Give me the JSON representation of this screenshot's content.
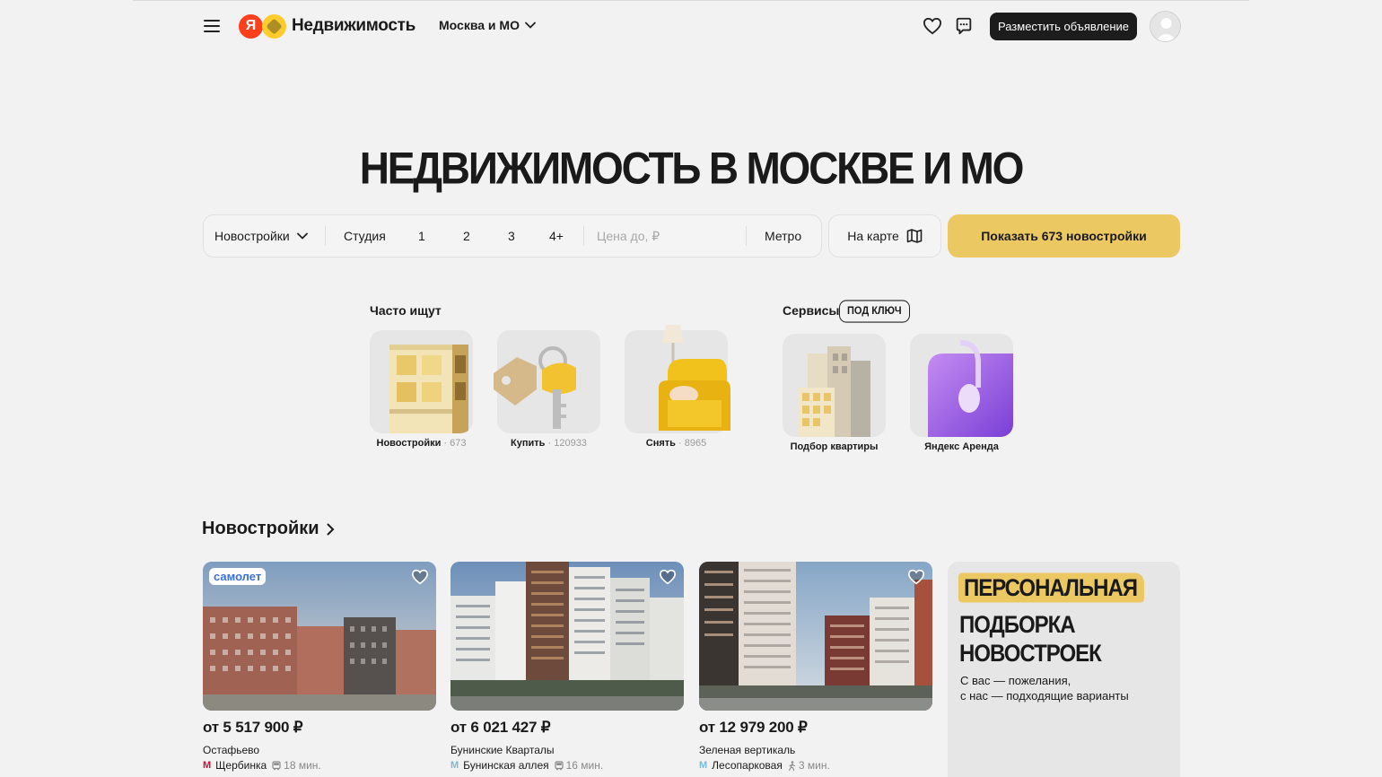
{
  "header": {
    "logo_letter": "Я",
    "logo_text": "Недвижимость",
    "region": "Москва и МО",
    "post_button": "Разместить объявление",
    "icons": [
      "menu-icon",
      "heart-icon",
      "chat-icon",
      "user-avatar"
    ]
  },
  "hero": {
    "title": "НЕДВИЖИМОСТЬ В МОСКВЕ И МО"
  },
  "search": {
    "type": "Новостройки",
    "rooms": [
      "Студия",
      "1",
      "2",
      "3",
      "4+"
    ],
    "price_placeholder": "Цена до, ₽",
    "metro": "Метро",
    "on_map": "На карте",
    "show_button": "Показать 673 новостройки"
  },
  "frequent": {
    "label": "Часто ищут",
    "items": [
      {
        "label": "Новостройки",
        "count": "· 673"
      },
      {
        "label": "Купить",
        "count": "· 120933"
      },
      {
        "label": "Снять",
        "count": "· 8965"
      }
    ]
  },
  "services": {
    "label": "Сервисы",
    "badge": "ПОД КЛЮЧ",
    "items": [
      {
        "label": "Подбор квартиры"
      },
      {
        "label": "Яндекс Аренда"
      }
    ]
  },
  "new_buildings": {
    "title": "Новостройки",
    "cards": [
      {
        "badge": "самолет",
        "price": "от 5 517 900 ₽",
        "name": "Остафьево",
        "metro_station": "Щербинка",
        "metro_color": "#d6083b",
        "travel": "18 мин.",
        "travel_mode": "bus"
      },
      {
        "badge": "",
        "price": "от 6 021 427 ₽",
        "name": "Бунинские Кварталы",
        "metro_station": "Бунинская аллея",
        "metro_color": "#80b7d9",
        "travel": "16 мин.",
        "travel_mode": "bus"
      },
      {
        "badge": "",
        "price": "от 12 979 200 ₽",
        "name": "Зеленая вертикаль",
        "metro_station": "Лесопарковая",
        "metro_color": "#80b7d9",
        "travel": "3 мин.",
        "travel_mode": "walk"
      }
    ],
    "promo": {
      "line1": "ПЕРСОНАЛЬНАЯ",
      "line2": "ПОДБОРКА",
      "line3": "НОВОСТРОЕК",
      "subtitle": "С вас — пожелания,\nс нас — подходящие варианты"
    }
  },
  "colors": {
    "accent": "#ebc862",
    "dark_button": "#1c1c1c",
    "background": "#f2f2f2",
    "brand_red": "#fc3f1d",
    "brand_yellow": "#ffcc2b"
  }
}
